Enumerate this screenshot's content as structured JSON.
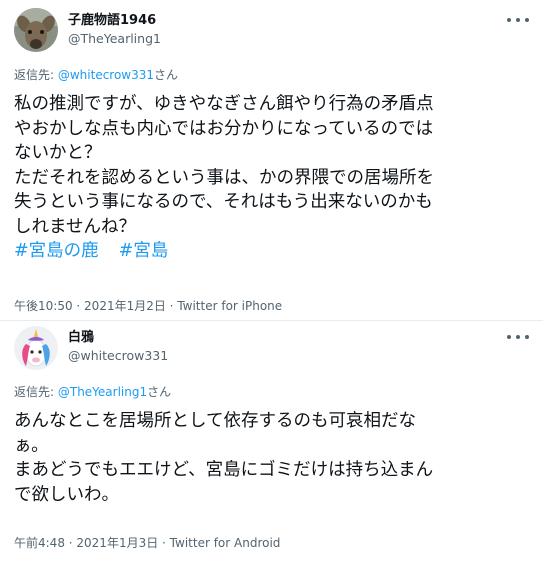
{
  "tweets": [
    {
      "display_name": "子鹿物語1946",
      "handle": "@TheYearling1",
      "reply_prefix": "返信先: ",
      "reply_handle": "@whitecrow331",
      "reply_suffix": "さん",
      "lines": [
        "私の推測ですが、ゆきやなぎさん餌やり行為の矛盾点",
        "やおかしな点も内心ではお分かりになっているのでは",
        "ないかと？",
        "ただそれを認めるという事は、かの界隈での居場所を",
        "失うという事になるので、それはもう出来ないのかも",
        "しれませんね？"
      ],
      "hashtags": [
        "#宮島の鹿",
        "#宮島"
      ],
      "time": "午後10:50",
      "date": "2021年1月2日",
      "client": "Twitter for iPhone"
    },
    {
      "display_name": "白鴉",
      "handle": "@whitecrow331",
      "reply_prefix": "返信先: ",
      "reply_handle": "@TheYearling1",
      "reply_suffix": "さん",
      "lines": [
        "あんなとこを居場所として依存するのも可哀相だな",
        "ぁ。",
        "まあどうでもエエけど、宮島にゴミだけは持ち込まん",
        "で欲しいわ。"
      ],
      "time": "午前4:48",
      "date": "2021年1月3日",
      "client": "Twitter for Android"
    }
  ],
  "meta_separator": " · ",
  "icons": {
    "more": "more-horizontal-icon",
    "avatar_1": "deer-avatar",
    "avatar_2": "unicorn-avatar"
  },
  "colors": {
    "link": "#1d9bf0",
    "secondary_text": "#536471",
    "primary_text": "#0f1419"
  }
}
